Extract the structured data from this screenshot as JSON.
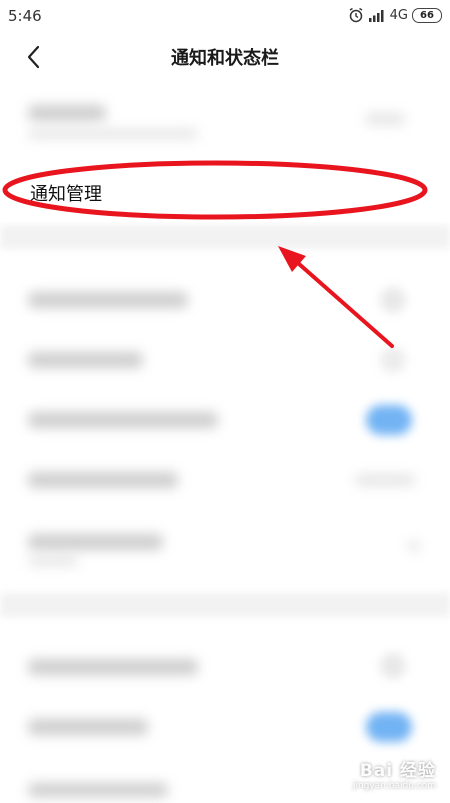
{
  "status_bar": {
    "time": "5:46",
    "network": "4G",
    "battery": "66"
  },
  "header": {
    "title": "通知和状态栏"
  },
  "main": {
    "highlighted_item": "通知管理"
  },
  "watermark": {
    "main": "Bai 经验",
    "sub": "jingyan.baidu.com"
  },
  "colors": {
    "annotation_red": "#e8141e",
    "toggle_blue": "#5aa6f2"
  },
  "icons": [
    "back-icon",
    "alarm-icon",
    "signal-icon",
    "arrow-icon"
  ]
}
